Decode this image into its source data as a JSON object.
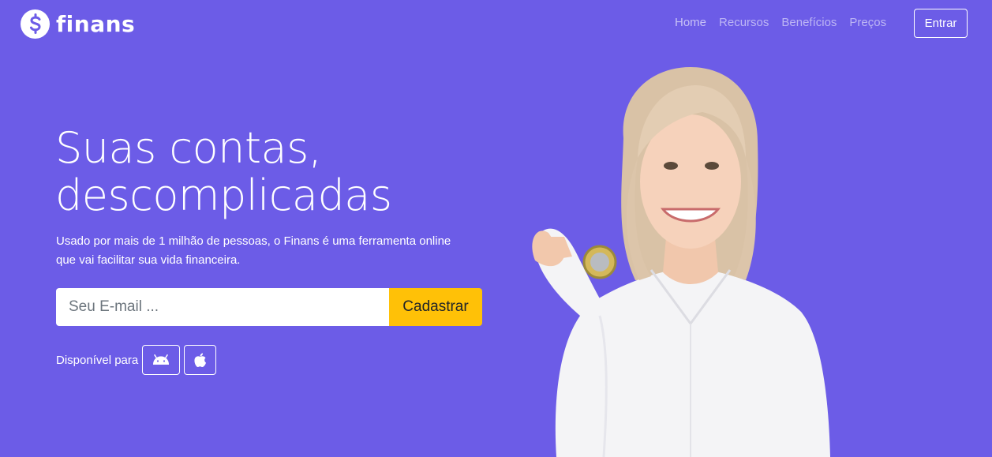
{
  "brand": {
    "name": "finans",
    "icon": "dollar-circle-icon"
  },
  "nav": {
    "links": [
      {
        "label": "Home"
      },
      {
        "label": "Recursos"
      },
      {
        "label": "Benefícios"
      },
      {
        "label": "Preços"
      }
    ],
    "login_label": "Entrar"
  },
  "hero": {
    "headline_line1": "Suas contas,",
    "headline_line2": "descomplicadas",
    "lead_line1": "Usado por mais de 1 milhão de pessoas, o Finans é uma ferramenta online",
    "lead_line2": "que vai facilitar sua vida financeira.",
    "email_placeholder": "Seu E-mail ...",
    "submit_label": "Cadastrar",
    "available_label": "Disponível para",
    "platform_icons": [
      "android-icon",
      "apple-icon"
    ]
  },
  "colors": {
    "background": "#6c5ce7",
    "accent": "#ffc107"
  }
}
